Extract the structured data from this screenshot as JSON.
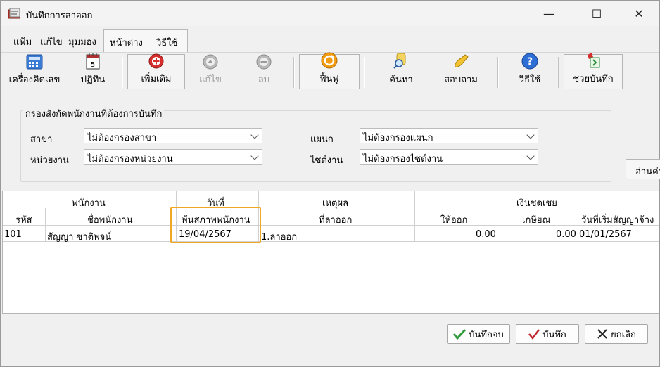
{
  "window": {
    "title": "บันทึกการลาออก",
    "minimize": "—",
    "maximize": "☐",
    "close": "✕"
  },
  "menu": {
    "file": "แฟ้ม",
    "edit": "แก้ไข",
    "view": "มุมมอง",
    "window": "หน้าต่าง",
    "help": "วิธีใช้"
  },
  "toolbar": {
    "calculator": "เครื่องคิดเลข",
    "calendar": "ปฏิทิน",
    "add": "เพิ่มเติม",
    "edit": "แก้ไข",
    "delete": "ลบ",
    "refresh": "ฟื้นฟู",
    "search": "ค้นหา",
    "query": "สอบถาม",
    "help": "วิธีใช้",
    "save_assist": "ช่วยบันทึก",
    "calendar_day": "5"
  },
  "filter": {
    "title": "กรองสังกัดพนักงานที่ต้องการบันทึก",
    "branch_label": "สาขา",
    "branch_value": "ไม่ต้องกรองสาขา",
    "department_label": "แผนก",
    "department_value": "ไม่ต้องกรองแผนก",
    "unit_label": "หน่วยงาน",
    "unit_value": "ไม่ต้องกรองหน่วยงาน",
    "site_label": "ไซต์งาน",
    "site_value": "ไม่ต้องกรองไซต์งาน",
    "read_button": "อ่านค่า"
  },
  "grid": {
    "group_headers": {
      "employee": "พนักงาน",
      "date": "วันที่",
      "reason": "เหตุผล",
      "compensation": "เงินชดเชย"
    },
    "columns": {
      "code": "รหัส",
      "name": "ชื่อพนักงาน",
      "termination_date": "พ้นสภาพพนักงาน",
      "reason": "ที่ลาออก",
      "leave_pay": "ให้ออก",
      "retire_pay": "เกษียณ",
      "start_date": "วันที่เริ่มสัญญาจ้าง"
    },
    "rows": [
      {
        "code": "101",
        "name": "สัญญา  ชาติพจน์",
        "termination_date": "19/04/2567",
        "reason": "1.ลาออก",
        "leave_pay": "0.00",
        "retire_pay": "0.00",
        "start_date": "01/01/2567"
      }
    ]
  },
  "footer": {
    "save_close": "บันทึกจบ",
    "save": "บันทึก",
    "cancel": "ยกเลิก"
  },
  "colors": {
    "highlight": "#f0a824"
  }
}
